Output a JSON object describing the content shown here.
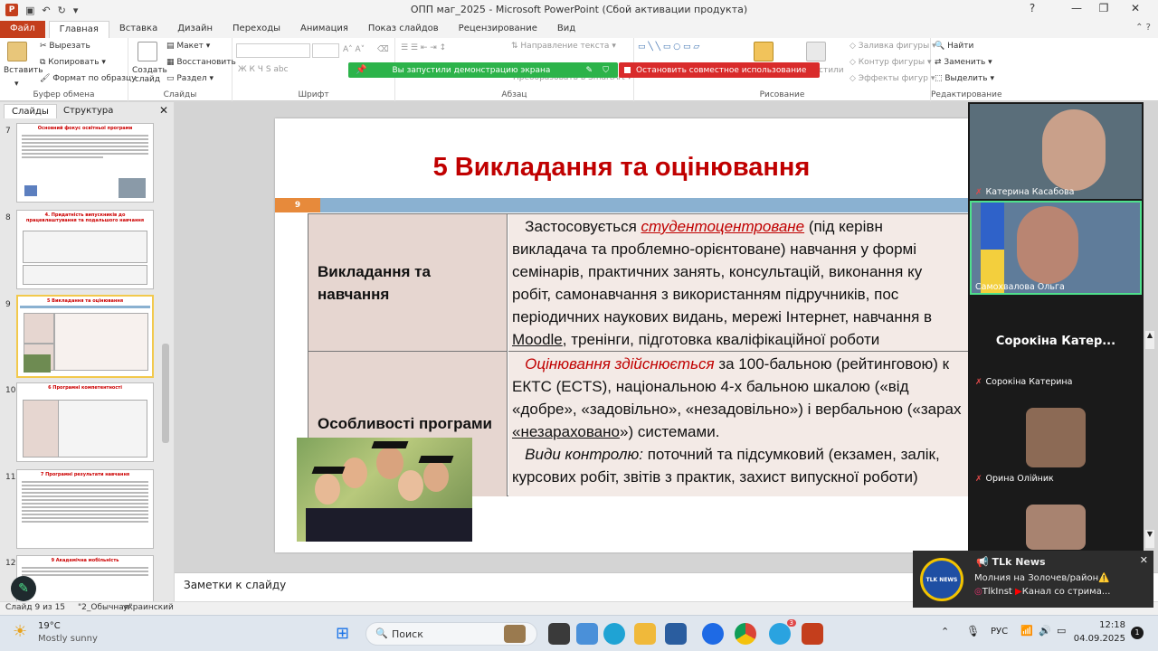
{
  "window": {
    "title": "ОПП маг_2025  -  Microsoft PowerPoint (Сбой активации продукта)",
    "app_icon": "P"
  },
  "ribbon_tabs": [
    {
      "label": "Файл"
    },
    {
      "label": "Главная"
    },
    {
      "label": "Вставка"
    },
    {
      "label": "Дизайн"
    },
    {
      "label": "Переходы"
    },
    {
      "label": "Анимация"
    },
    {
      "label": "Показ слайдов"
    },
    {
      "label": "Рецензирование"
    },
    {
      "label": "Вид"
    }
  ],
  "ribbon": {
    "clipboard": {
      "paste": "Вставить",
      "cut": "Вырезать",
      "copy": "Копировать",
      "format_painter": "Формат по образцу",
      "group": "Буфер обмена"
    },
    "slides": {
      "new_slide": "Создать слайд",
      "layout": "Макет",
      "reset": "Восстановить",
      "section": "Раздел",
      "group": "Слайды"
    },
    "font": {
      "group": "Шрифт"
    },
    "paragraph": {
      "text_direction": "Направление текста",
      "smartart": "Преобразовать в SmartArt",
      "group": "Абзац"
    },
    "drawing": {
      "styles": "стили",
      "fill": "Заливка фигуры",
      "outline": "Контур фигуры",
      "effects": "Эффекты фигур",
      "group": "Рисование"
    },
    "editing": {
      "find": "Найти",
      "replace": "Заменить",
      "select": "Выделить",
      "group": "Редактирование"
    }
  },
  "share_banner": {
    "text": "Вы запустили демонстрацию экрана",
    "stop": "Остановить совместное использование"
  },
  "panel": {
    "tab_slides": "Слайды",
    "tab_outline": "Структура"
  },
  "thumbnails": [
    {
      "num": "7",
      "title": "Основний фокус освітньої програми"
    },
    {
      "num": "8",
      "title": "4. Придатність випускників до працевлаштування та подальшого навчання"
    },
    {
      "num": "9",
      "title": "5 Викладання та оцінювання"
    },
    {
      "num": "10",
      "title": "6 Програмні компетентності"
    },
    {
      "num": "11",
      "title": "7 Програмні результати навчання"
    },
    {
      "num": "12",
      "title": "9 Академічна мобільність"
    }
  ],
  "slide": {
    "title": "5 Викладання та оцінювання",
    "number": "9",
    "row1_head": "Викладання та навчання",
    "row1_lines": [
      {
        "a": "Застосовується ",
        "b": "студентоцентроване",
        "c": " (під керівн"
      },
      {
        "text": "викладача та проблемно-орієнтоване) навчання у формі"
      },
      {
        "text": "семінарів, практичних занять, консультацій, виконання ку"
      },
      {
        "text": "робіт, самонавчання з використанням підручників, пос"
      },
      {
        "text": "періодичних наукових видань, мережі Інтернет, навчання в"
      },
      {
        "a": "Moodle",
        "c": ", тренінги, підготовка кваліфікаційної роботи"
      }
    ],
    "row2_head": "Особливості програми",
    "row2_lines": [
      {
        "a": "Оцінювання здійснюється",
        "c": " за 100-бальною (рейтинговою) к"
      },
      {
        "text": "ЕКТС (ECTS), національною 4-х бальною шкалою («від"
      },
      {
        "text": "«добре», «задовільно», «незадовільно») і вербальною («зарах"
      },
      {
        "a": "«незараховано",
        "c": "») системами."
      },
      {
        "a": "Види контролю:",
        "c": " поточний та  підсумковий (екзамен, залік,"
      },
      {
        "text": "курсових робіт, звітів з практик, захист випускної роботи)"
      }
    ]
  },
  "notes_placeholder": "Заметки к слайду",
  "status": {
    "slide_pos": "Слайд 9 из 15",
    "theme": "\"2_Обычная\"",
    "language": "украинский"
  },
  "participants": [
    {
      "name": "Катерина Касабова",
      "muted": true
    },
    {
      "name": "Самохвалова Ольга",
      "muted": false,
      "active": true
    },
    {
      "name": "Сорокіна Катерина",
      "display": "Сорокіна Катер...",
      "muted": true
    },
    {
      "name": "Орина Олійник",
      "muted": true
    },
    {
      "name": "",
      "muted": true
    }
  ],
  "toast": {
    "app": "TLk News",
    "line1": "Молния на Золочев/район⚠️",
    "line2a": "TlkInst",
    "line2b": "Канал со стрима...",
    "logo": "TLK NEWS"
  },
  "taskbar": {
    "weather_temp": "19°C",
    "weather_desc": "Mostly sunny",
    "search": "Поиск",
    "lang": "РУС",
    "time": "12:18",
    "date": "04.09.2025",
    "notif_count": "1",
    "telegram_badge": "3"
  }
}
